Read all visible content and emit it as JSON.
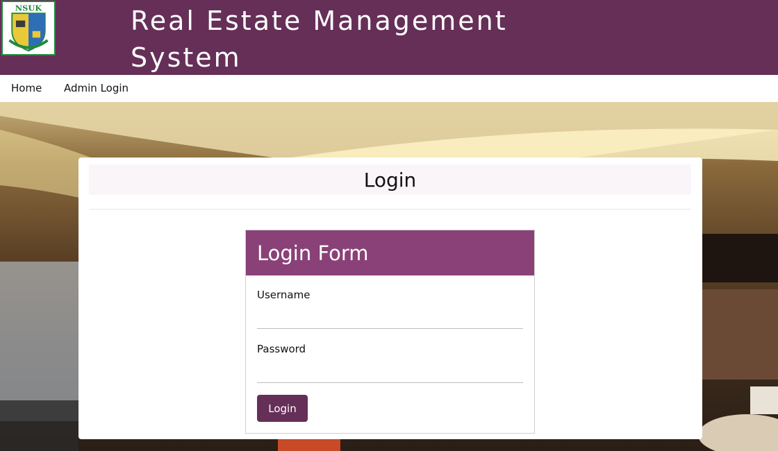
{
  "header": {
    "logo_text": "NSUK",
    "title": "Real Estate Management System"
  },
  "nav": {
    "home": "Home",
    "admin_login": "Admin Login"
  },
  "card": {
    "title": "Login"
  },
  "login_form": {
    "title": "Login Form",
    "username_label": "Username",
    "username_value": "",
    "password_label": "Password",
    "password_value": "",
    "submit_label": "Login"
  },
  "colors": {
    "brand": "#652f58",
    "form_header": "#8a4177"
  }
}
